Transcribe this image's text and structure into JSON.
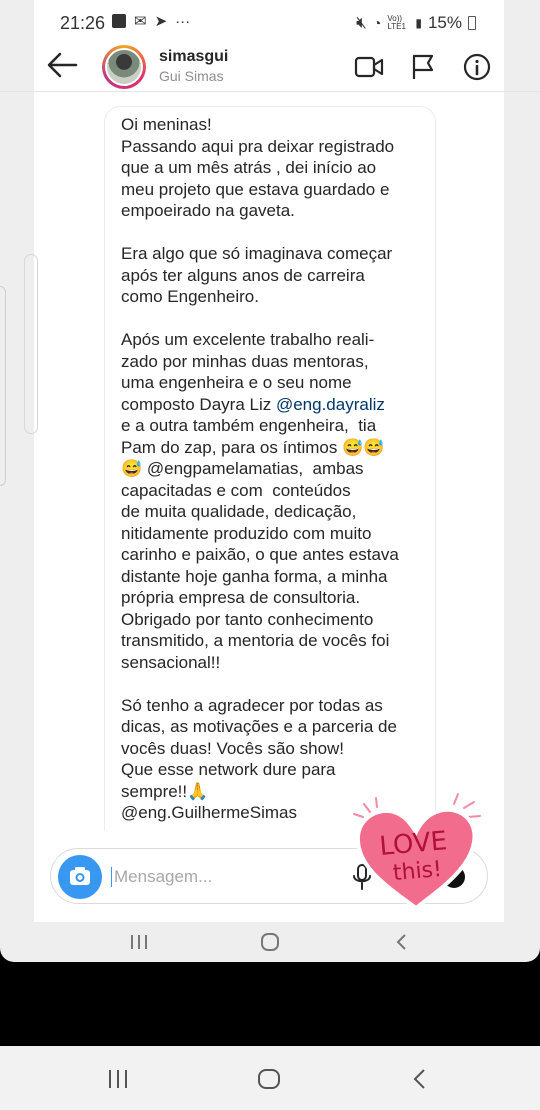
{
  "status_bar": {
    "time": "21:26",
    "battery": "15%",
    "network_label": "Vo)) LTE1"
  },
  "header": {
    "username": "simasgui",
    "full_name": "Gui Simas"
  },
  "message": {
    "parts": [
      {
        "text": "Oi meninas!\nPassando aqui pra deixar registrado\nque a um mês atrás , dei início ao\nmeu projeto que estava guardado e\nempoeirado na gaveta.\n\nEra algo que só imaginava começar\napós ter alguns anos de carreira\ncomo Engenheiro.\n\nApós um excelente trabalho reali-\nzado por minhas duas mentoras,\numa engenheira e o seu nome\ncomposto Dayra Liz "
      },
      {
        "text": "@eng.dayraliz",
        "mention": true
      },
      {
        "text": "\ne a outra também engenheira,  tia\nPam do zap, para os íntimos 😅😅\n😅 @engpamelamatias,  ambas\ncapacitadas e com  conteúdos\nde muita qualidade, dedicação,\nnitidamente produzido com muito\ncarinho e paixão, o que antes estava\ndistante hoje ganha forma, a minha\nprópria empresa de consultoria.\nObrigado por tanto conhecimento\ntransmitido, a mentoria de vocês foi\nsensacional!!\n\nSó tenho a agradecer por todas as\ndicas, as motivações e a parceria de\nvocês duas! Vocês são show!\nQue esse network dure para\nsempre!!🙏\n@eng.GuilhermeSimas"
      }
    ]
  },
  "composer": {
    "placeholder": "Mensagem..."
  },
  "sticker": {
    "line1": "LOVE",
    "line2": "this!"
  },
  "colors": {
    "accent": "#3897f0",
    "mention": "#00376b",
    "sticker_fill": "#f06a8a",
    "sticker_text": "#b0103a"
  }
}
